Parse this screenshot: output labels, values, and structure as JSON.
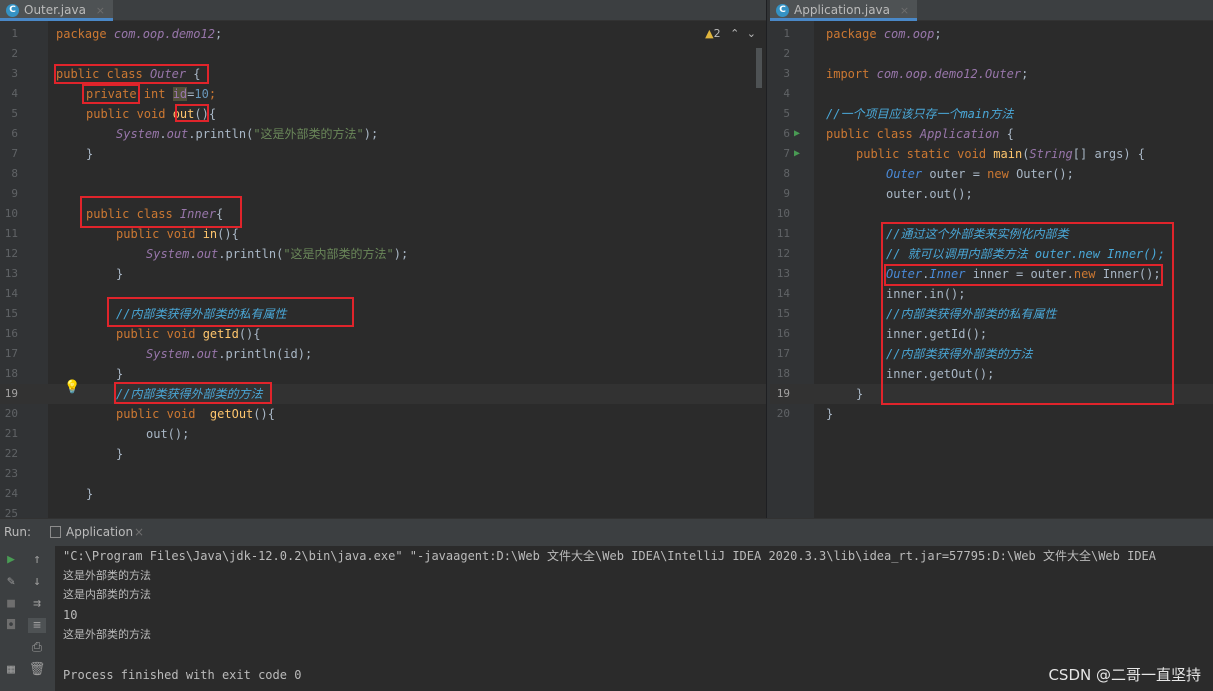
{
  "left_tab": {
    "label": "Outer.java",
    "icon": "class-icon"
  },
  "right_tab": {
    "label": "Application.java",
    "icon": "class-icon"
  },
  "inspection": {
    "warnings": "2"
  },
  "left_lines": [
    {
      "n": "1"
    },
    {
      "n": "2"
    },
    {
      "n": "3"
    },
    {
      "n": "4"
    },
    {
      "n": "5"
    },
    {
      "n": "6"
    },
    {
      "n": "7"
    },
    {
      "n": "8"
    },
    {
      "n": "9"
    },
    {
      "n": "10"
    },
    {
      "n": "11"
    },
    {
      "n": "12"
    },
    {
      "n": "13"
    },
    {
      "n": "14"
    },
    {
      "n": "15"
    },
    {
      "n": "16"
    },
    {
      "n": "17"
    },
    {
      "n": "18"
    },
    {
      "n": "19"
    },
    {
      "n": "20"
    },
    {
      "n": "21"
    },
    {
      "n": "22"
    },
    {
      "n": "23"
    },
    {
      "n": "24"
    },
    {
      "n": "25"
    }
  ],
  "left_code": {
    "l1_kw": "package",
    "l1_pkg": "com.oop.demo12",
    "l1_end": ";",
    "l3_kw": "public class",
    "l3_cls": "Outer",
    "l3_end": " {",
    "l4_kw": "private",
    "l4_type": " int ",
    "l4_var": "id",
    "l4_eq": "=",
    "l4_num": "10",
    "l4_end": ";",
    "l5_kw": "public void ",
    "l5_fn": "out",
    "l5_end": "(){",
    "l6_sys": "System",
    "l6_dot": ".",
    "l6_out": "out",
    "l6_call": ".println(",
    "l6_str": "\"这是外部类的方法\"",
    "l6_end": ");",
    "l7": "}",
    "l10_kw": "public class ",
    "l10_cls": "Inner",
    "l10_end": "{",
    "l11_kw": "public void ",
    "l11_fn": "in",
    "l11_end": "(){",
    "l12_sys": "System",
    "l12_dot": ".",
    "l12_out": "out",
    "l12_call": ".println(",
    "l12_str": "\"这是内部类的方法\"",
    "l12_end": ");",
    "l13": "}",
    "l15_cmt": "//内部类获得外部类的私有属性",
    "l16_kw": "public void ",
    "l16_fn": "getId",
    "l16_end": "(){",
    "l17_sys": "System",
    "l17_dot": ".",
    "l17_out": "out",
    "l17_call": ".println(id);",
    "l18": "}",
    "l19_cmt": "//内部类获得外部类的方法",
    "l20_kw": "public void  ",
    "l20_fn": "getOut",
    "l20_end": "(){",
    "l21": "out();",
    "l22": "}",
    "l24": "}"
  },
  "right_lines": [
    {
      "n": "1"
    },
    {
      "n": "2"
    },
    {
      "n": "3"
    },
    {
      "n": "4"
    },
    {
      "n": "5"
    },
    {
      "n": "6"
    },
    {
      "n": "7"
    },
    {
      "n": "8"
    },
    {
      "n": "9"
    },
    {
      "n": "10"
    },
    {
      "n": "11"
    },
    {
      "n": "12"
    },
    {
      "n": "13"
    },
    {
      "n": "14"
    },
    {
      "n": "15"
    },
    {
      "n": "16"
    },
    {
      "n": "17"
    },
    {
      "n": "18"
    },
    {
      "n": "19"
    },
    {
      "n": "20"
    }
  ],
  "right_code": {
    "l1_kw": "package",
    "l1_pkg": "com.oop",
    "l1_end": ";",
    "l3_kw": "import",
    "l3_pkg": "com.oop.demo12.Outer",
    "l3_end": ";",
    "l5_cmt": "//一个项目应该只存一个main方法",
    "l6_kw": "public class ",
    "l6_cls": "Application",
    "l6_end": " {",
    "l7_kw": "public static void ",
    "l7_fn": "main",
    "l7_p": "(",
    "l7_type": "String",
    "l7_end": "[] args) {",
    "l8_type": "Outer",
    "l8_mid": " outer = ",
    "l8_kw": "new",
    "l8_end": " Outer();",
    "l9": "outer.out();",
    "l11_cmt": "//通过这个外部类来实例化内部类",
    "l12_cmt": "// 就可以调用内部类方法 outer.new Inner();",
    "l13_type": "Outer",
    "l13_dot": ".",
    "l13_type2": "Inner",
    "l13_mid": " inner = outer.",
    "l13_kw": "new",
    "l13_end": " Inner();",
    "l14": "inner.in();",
    "l15_cmt": "//内部类获得外部类的私有属性",
    "l16": "inner.getId();",
    "l17_cmt": "//内部类获得外部类的方法",
    "l18": "inner.getOut();",
    "l19": "}",
    "l20": "}"
  },
  "run": {
    "label": "Run:",
    "tab": "Application",
    "output": [
      "\"C:\\Program Files\\Java\\jdk-12.0.2\\bin\\java.exe\" \"-javaagent:D:\\Web 文件大全\\Web IDEA\\IntelliJ IDEA 2020.3.3\\lib\\idea_rt.jar=57795:D:\\Web 文件大全\\Web IDEA",
      "这是外部类的方法",
      "这是内部类的方法",
      "10",
      "这是外部类的方法",
      "",
      "Process finished with exit code 0"
    ]
  },
  "watermark": "CSDN @二哥一直坚持",
  "colors": {
    "highlight_box": "#e0242b",
    "keyword": "#cc7832",
    "string": "#6a8759",
    "comment": "#629755"
  }
}
